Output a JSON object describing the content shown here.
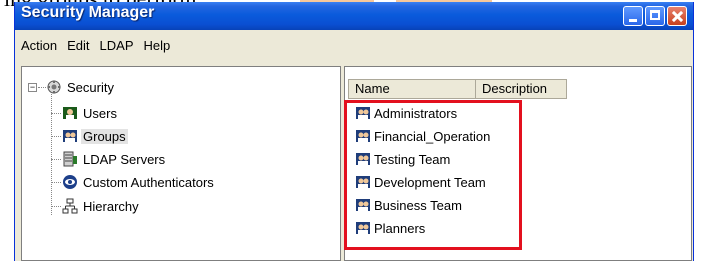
{
  "above_text": {
    "fragment": "ing groups to perform",
    "highlight_color": "#f7c79a"
  },
  "window": {
    "title": "Security Manager",
    "menu": [
      "Action",
      "Edit",
      "LDAP",
      "Help"
    ]
  },
  "tree": {
    "root": {
      "label": "Security",
      "icon": "security-icon",
      "expander": "−"
    },
    "children": [
      {
        "label": "Users",
        "icon": "users-icon"
      },
      {
        "label": "Groups",
        "icon": "groups-icon",
        "selected": true
      },
      {
        "label": "LDAP Servers",
        "icon": "ldap-servers-icon"
      },
      {
        "label": "Custom Authenticators",
        "icon": "custom-authenticators-icon"
      },
      {
        "label": "Hierarchy",
        "icon": "hierarchy-icon"
      }
    ]
  },
  "list": {
    "columns": [
      "Name",
      "Description"
    ],
    "items": [
      {
        "name": "Administrators",
        "icon": "group-icon"
      },
      {
        "name": "Financial_Operation",
        "icon": "group-icon"
      },
      {
        "name": "Testing Team",
        "icon": "group-icon"
      },
      {
        "name": "Development Team",
        "icon": "group-icon"
      },
      {
        "name": "Business Team",
        "icon": "group-icon"
      },
      {
        "name": "Planners",
        "icon": "group-icon"
      }
    ],
    "highlight_color": "#e3101e"
  }
}
